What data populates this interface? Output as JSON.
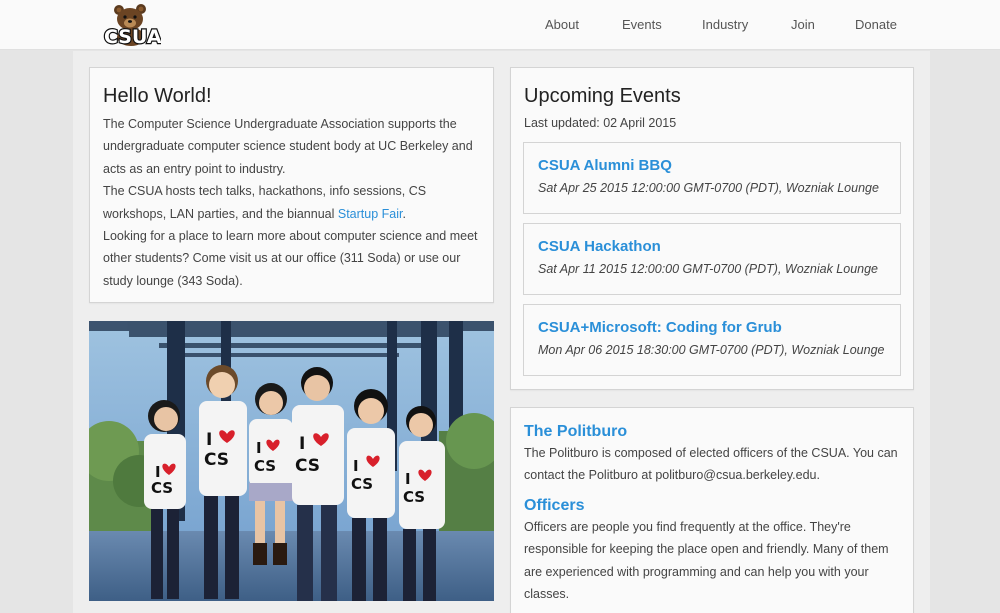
{
  "nav": {
    "logo_text": "CSUA",
    "links": [
      "About",
      "Events",
      "Industry",
      "Join",
      "Donate"
    ]
  },
  "hello": {
    "title": "Hello World!",
    "para1": "The Computer Science Undergraduate Association supports the undergraduate computer science student body at UC Berkeley and acts as an entry point to industry.",
    "para2_before": "The CSUA hosts tech talks, hackathons, info sessions, CS workshops, LAN parties, and the biannual ",
    "para2_link": "Startup Fair",
    "para2_after": ".",
    "para3": "Looking for a place to learn more about computer science and meet other students? Come visit us at our office (311 Soda) or use our study lounge (343 Soda)."
  },
  "photo": {
    "shirt_text_top": "I",
    "shirt_text_bottom": "CS"
  },
  "events": {
    "title": "Upcoming Events",
    "updated": "Last updated: 02 April 2015",
    "items": [
      {
        "title": "CSUA Alumni BBQ",
        "meta": "Sat Apr 25 2015 12:00:00 GMT-0700 (PDT), Wozniak Lounge"
      },
      {
        "title": "CSUA Hackathon",
        "meta": "Sat Apr 11 2015 12:00:00 GMT-0700 (PDT), Wozniak Lounge"
      },
      {
        "title": "CSUA+Microsoft: Coding for Grub",
        "meta": "Mon Apr 06 2015 18:30:00 GMT-0700 (PDT), Wozniak Lounge"
      }
    ]
  },
  "politburo": {
    "heading": "The Politburo",
    "text": "The Politburo is composed of elected officers of the CSUA. You can contact the Politburo at politburo@csua.berkeley.edu.",
    "officers_heading": "Officers",
    "officers_text": "Officers are people you find frequently at the office. They're responsible for keeping the place open and friendly. Many of them are experienced with programming and can help you with your classes."
  },
  "colors": {
    "accent": "#2a8fd8",
    "heart": "#d8202b"
  }
}
